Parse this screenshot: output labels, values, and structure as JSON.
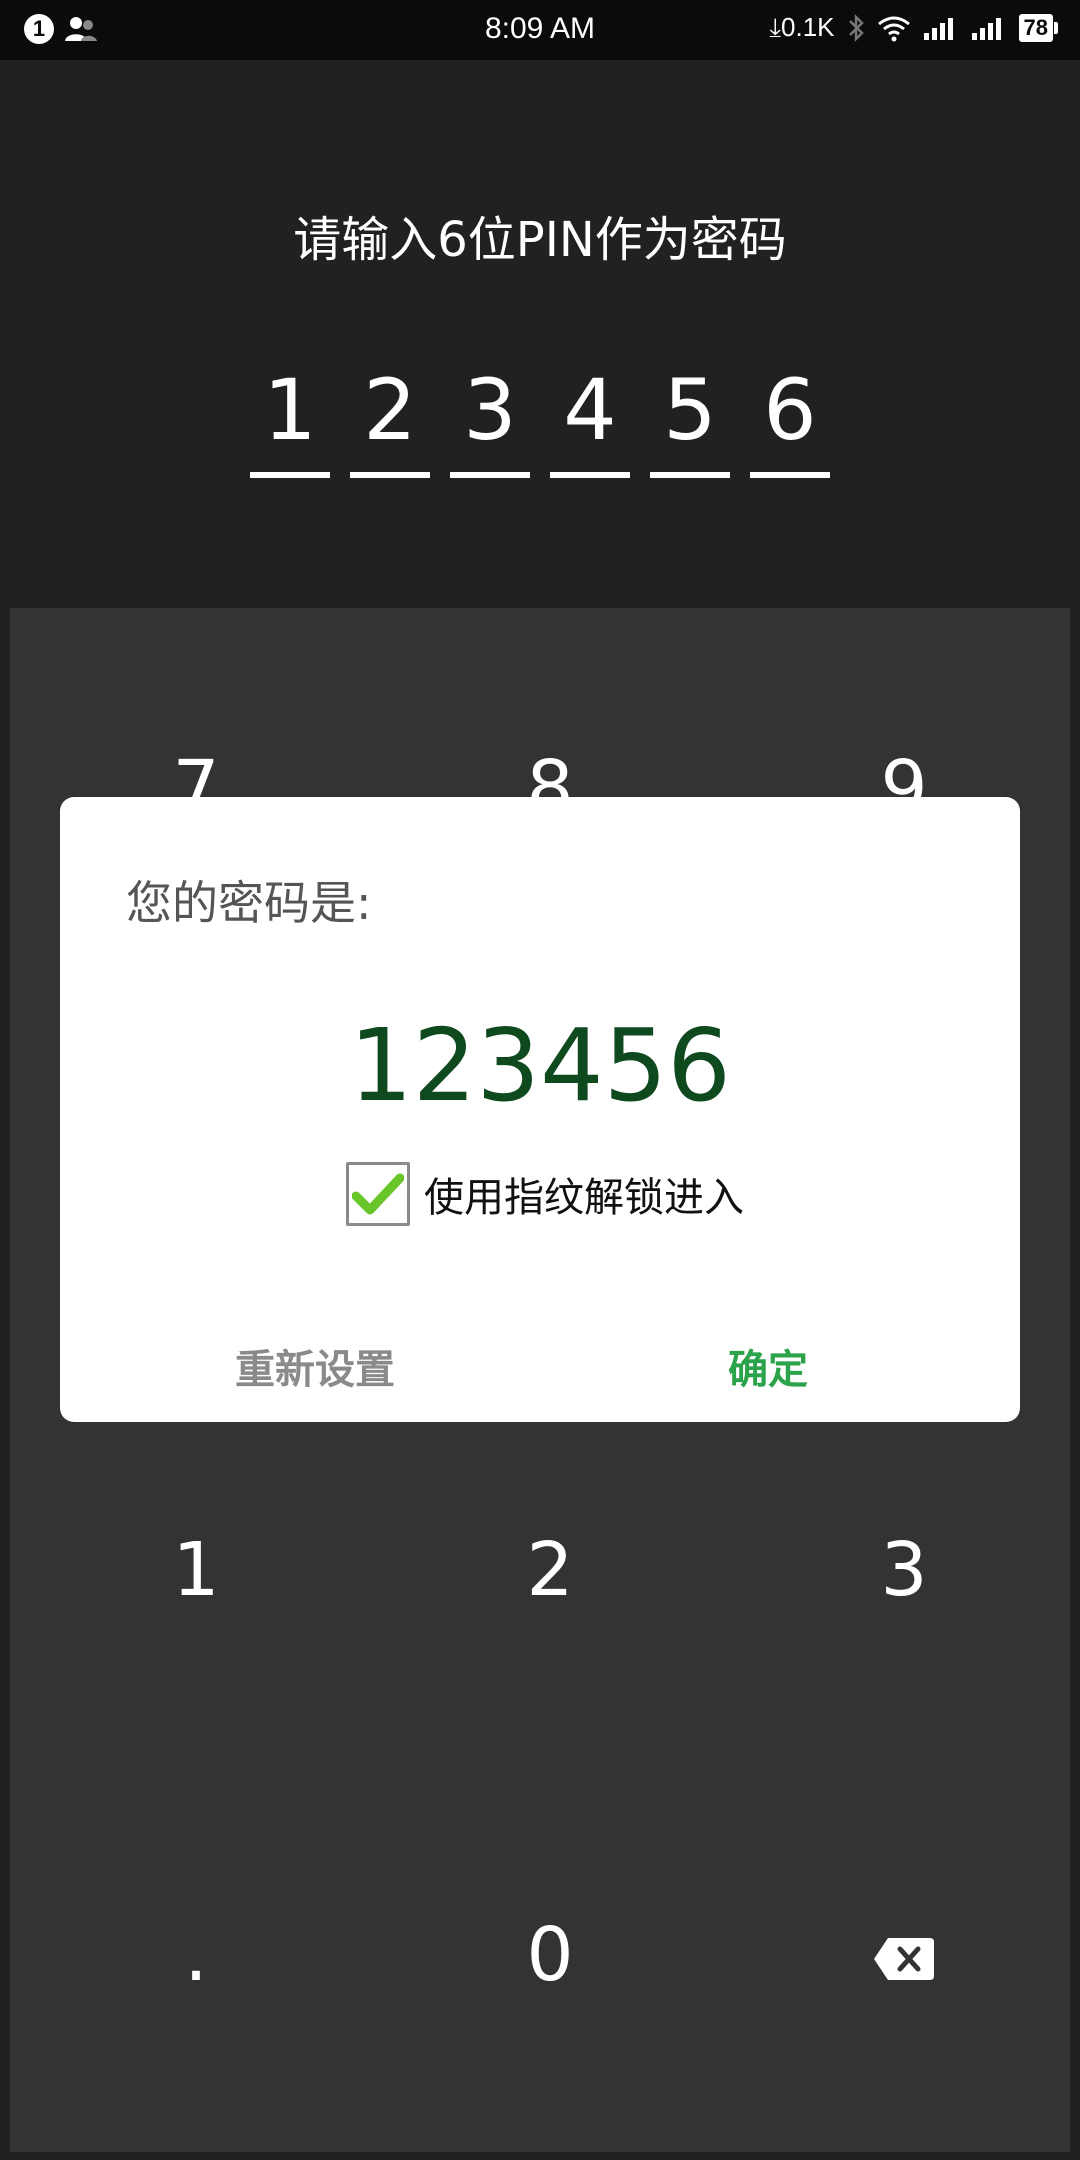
{
  "status_bar": {
    "notification_count": "1",
    "time": "8:09 AM",
    "network_speed": "0.1K",
    "battery": "78"
  },
  "pin_screen": {
    "title": "请输入6位PIN作为密码",
    "digits": [
      "1",
      "2",
      "3",
      "4",
      "5",
      "6"
    ]
  },
  "keypad": {
    "keys_row_top": [
      "7",
      "8",
      "9"
    ],
    "keys_row_mid": [
      "1",
      "2",
      "3"
    ],
    "keys_row_bottom": [
      ".",
      "0"
    ]
  },
  "dialog": {
    "title": "您的密码是:",
    "password": "123456",
    "fingerprint_label": "使用指纹解锁进入",
    "fingerprint_checked": true,
    "reset_label": "重新设置",
    "confirm_label": "确定"
  },
  "colors": {
    "background": "#212121",
    "keypad": "#333333",
    "password_text": "#0f4a1f",
    "confirm": "#2aa34a",
    "reset": "#8a8a8a"
  }
}
